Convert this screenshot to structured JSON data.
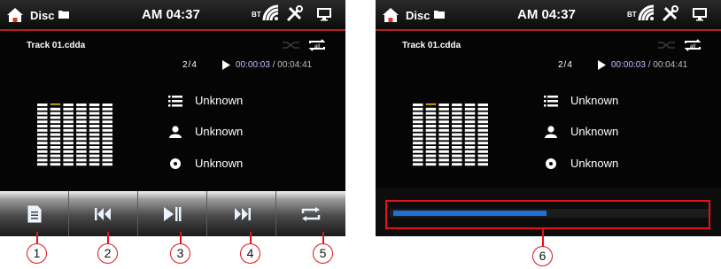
{
  "status_bar": {
    "source": "Disc",
    "time": "AM 04:37",
    "bt_label": "BT"
  },
  "track": {
    "name": "Track 01.cdda",
    "index": "2/4",
    "elapsed": "00:00:03",
    "separator": "/",
    "total": "00:04:41"
  },
  "info": {
    "album": "Unknown",
    "artist": "Unknown",
    "genre": "Unknown"
  },
  "equalizer": {
    "levels": [
      0.92,
      0.85,
      0.92,
      0.95,
      0.95,
      0.95
    ]
  },
  "progress": {
    "fraction": 0.49
  },
  "callouts": [
    "1",
    "2",
    "3",
    "4",
    "5",
    "6"
  ],
  "colors": {
    "accent_red": "#e0141b",
    "progress_blue": "#1f6fd6",
    "eq_peak": "#ffd200"
  },
  "icons": {
    "home": "home-icon",
    "folder": "folder-icon",
    "bluetooth_signal": "bluetooth-signal-icon",
    "tools": "tools-icon",
    "monitor": "monitor-icon",
    "shuffle": "shuffle-icon",
    "repeat_all": "repeat-all-icon",
    "list": "list-icon",
    "artist": "person-icon",
    "disc": "disc-icon",
    "playlist": "playlist-icon",
    "prev": "previous-track-icon",
    "play_pause": "play-pause-icon",
    "next": "next-track-icon",
    "repeat": "repeat-icon"
  }
}
